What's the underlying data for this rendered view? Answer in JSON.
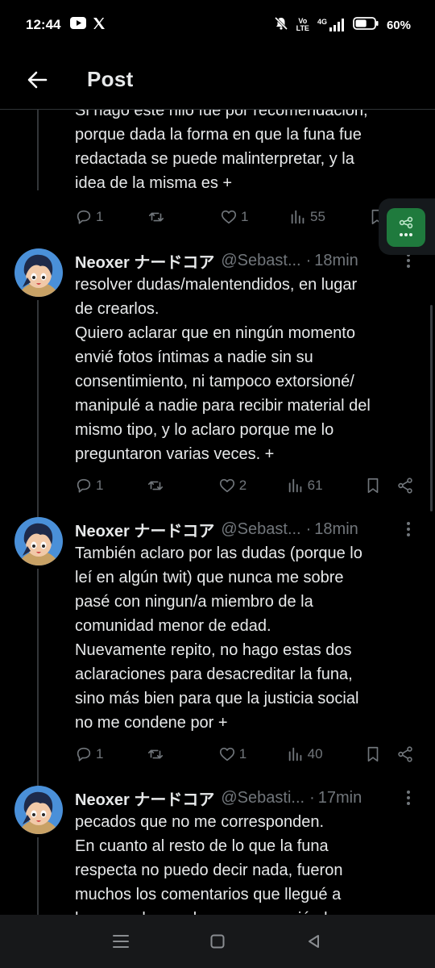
{
  "status_bar": {
    "time": "12:44",
    "volte_top": "Vo",
    "volte_bottom": "LTE",
    "network": "4G",
    "battery": "60%",
    "battery_level": 0.6
  },
  "header": {
    "title": "Post"
  },
  "top_tweet": {
    "text": "Si hago este hilo fue por recomendación,\nporque dada la forma en que la funa fue\nredactada se puede malinterpretar, y la\nidea de la misma es +",
    "replies": "1",
    "reposts": "",
    "likes": "1",
    "views": "55"
  },
  "tweets": [
    {
      "name": "Neoxer ナードコア",
      "handle": "@Sebast...",
      "time": "18min",
      "text": "resolver dudas/malentendidos, en lugar\nde crearlos.\nQuiero aclarar que en ningún momento\nenvié fotos íntimas a nadie sin su\nconsentimiento, ni tampoco extorsioné/\nmanipulé a nadie para recibir material del\nmismo tipo, y lo aclaro porque me lo\npreguntaron varias veces. +",
      "replies": "1",
      "reposts": "",
      "likes": "2",
      "views": "61"
    },
    {
      "name": "Neoxer ナードコア",
      "handle": "@Sebast...",
      "time": "18min",
      "text": "También aclaro por las dudas (porque lo\nleí en algún twit) que nunca me sobre\npasé con ningun/a miembro de la\ncomunidad menor de edad.\nNuevamente repito, no hago estas dos\naclaraciones para desacreditar la funa,\nsino más bien para que la justicia social\nno me condene por +",
      "replies": "1",
      "reposts": "",
      "likes": "1",
      "views": "40"
    },
    {
      "name": "Neoxer ナードコア",
      "handle": "@Sebasti...",
      "time": "17min",
      "text": "pecados que no me corresponden.\nEn cuanto al resto de lo que la funa\nrespecta no puedo decir nada, fueron\nmuchos los comentarios que llegué a\nhacer en los cuales menosprecié al"
    }
  ],
  "colors": {
    "background": "#000000",
    "text": "#e7e9ea",
    "muted": "#71767b",
    "divider": "#2f3336",
    "floating_button": "#1f7a3d",
    "nav_bar": "#17181a"
  },
  "icons": {
    "back": "arrow-left-icon",
    "reply": "reply-icon",
    "repost": "repost-icon",
    "like": "heart-icon",
    "views": "views-icon",
    "bookmark": "bookmark-icon",
    "share": "share-icon",
    "more": "more-icon"
  }
}
